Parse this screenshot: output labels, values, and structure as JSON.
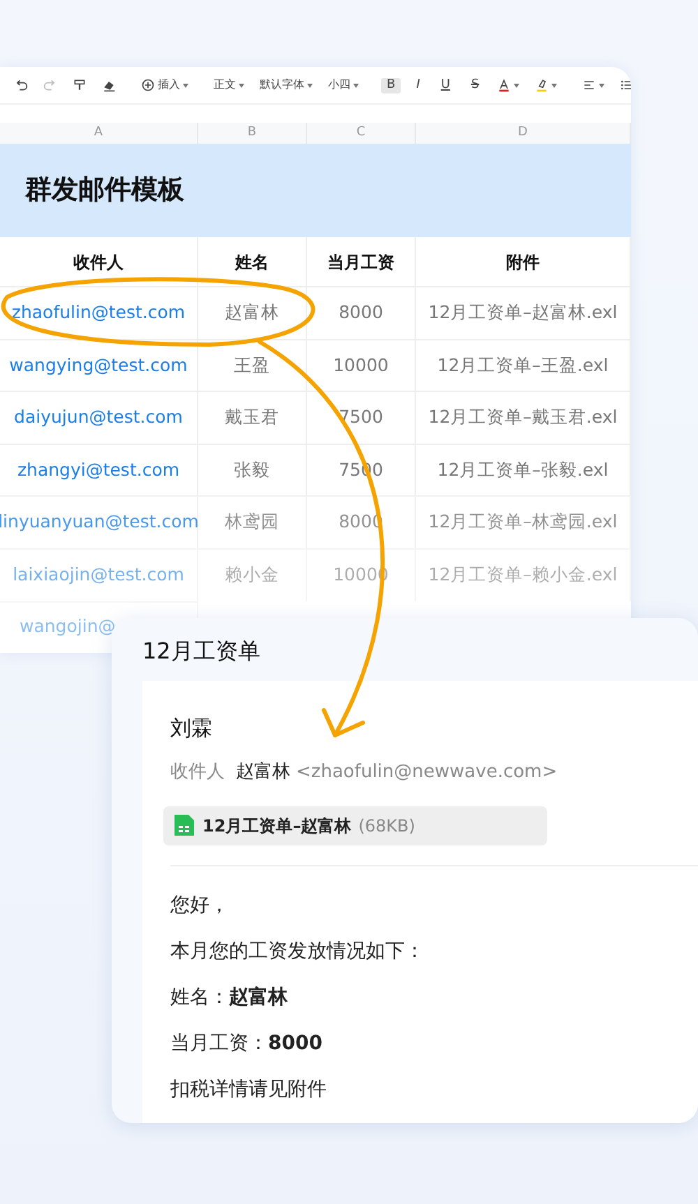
{
  "toolbar": {
    "undo": {
      "disabled": false
    },
    "redo": {
      "disabled": true
    },
    "insert": "插入",
    "style": "正文",
    "font": "默认字体",
    "size": "小四",
    "bold": {
      "label": "B",
      "selected": true
    },
    "italic": {
      "label": "I",
      "selected": false
    },
    "underline": {
      "label": "U",
      "selected": false
    },
    "strike": {
      "label": "S",
      "selected": false
    }
  },
  "column_letters": [
    "A",
    "B",
    "C",
    "D"
  ],
  "sheet_title": "群发邮件模板",
  "table": {
    "columns": [
      "收件人",
      "姓名",
      "当月工资",
      "附件"
    ],
    "rows": [
      {
        "cells": [
          "zhaofulin@test.com",
          "赵富林",
          "8000",
          "12月工资单–赵富林.exl"
        ]
      },
      {
        "cells": [
          "wangying@test.com",
          "王盈",
          "10000",
          "12月工资单–王盈.exl"
        ]
      },
      {
        "cells": [
          "daiyujun@test.com",
          "戴玉君",
          "7500",
          "12月工资单–戴玉君.exl"
        ]
      },
      {
        "cells": [
          "zhangyi@test.com",
          "张毅",
          "7500",
          "12月工资单–张毅.exl"
        ]
      },
      {
        "cells": [
          "linyuanyuan@test.com",
          "林鸢园",
          "8000",
          "12月工资单–林鸢园.exl"
        ]
      },
      {
        "cells": [
          "laixiaojin@test.com",
          "赖小金",
          "10000",
          "12月工资单–赖小金.exl"
        ]
      },
      {
        "cells": [
          "wangojin@"
        ]
      }
    ]
  },
  "email": {
    "title": "12月工资单",
    "sender": "刘霖",
    "recipient_label": "收件人",
    "recipient_name": "赵富林",
    "recipient_address": "<zhaofulin@newwave.com>",
    "attachment": {
      "name": "12月工资单–赵富林",
      "size": "(68KB)"
    },
    "body": [
      "您好，",
      "本月您的工资发放情况如下：",
      "姓名：**赵富林**",
      "当月工资：**8000**",
      "扣税详情请见附件"
    ]
  }
}
